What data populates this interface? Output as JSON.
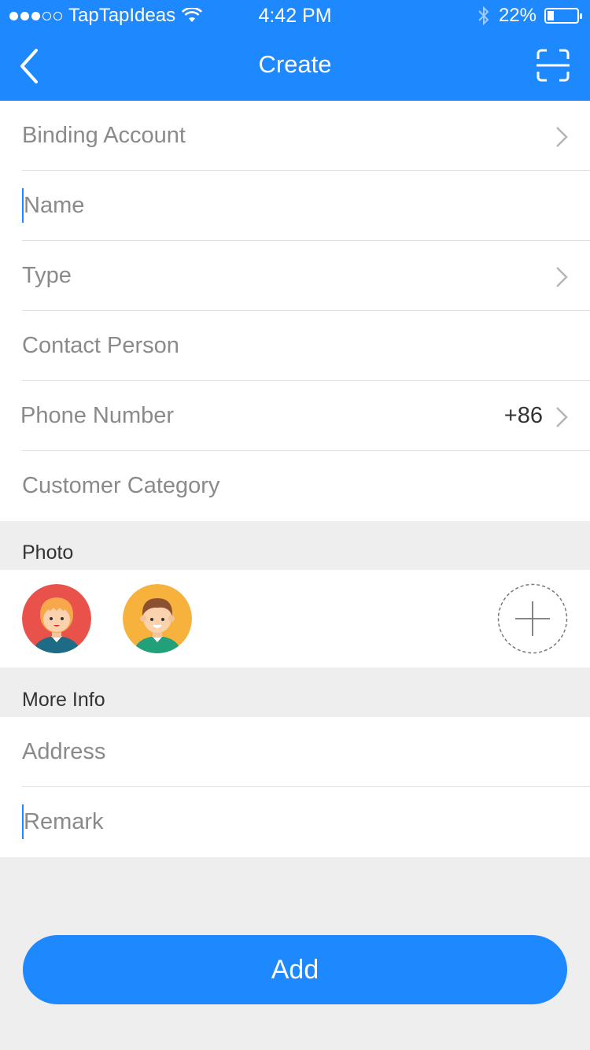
{
  "status_bar": {
    "carrier": "TapTapIdeas",
    "time": "4:42 PM",
    "battery_percent": "22%",
    "battery_level": 0.22,
    "signal_bars": 3,
    "signal_total": 5
  },
  "nav": {
    "title": "Create",
    "back_icon": "chevron-left-icon",
    "scan_icon": "scan-icon"
  },
  "form": {
    "binding_account": "Binding Account",
    "name_placeholder": "Name",
    "type": "Type",
    "contact_person": "Contact Person",
    "phone_number": "Phone Number",
    "phone_code": "+86",
    "customer_category": "Customer Category"
  },
  "photo": {
    "title": "Photo",
    "avatars": [
      "female-avatar",
      "male-avatar"
    ],
    "add_icon": "plus-icon"
  },
  "more_info": {
    "title": "More Info",
    "address": "Address",
    "remark_placeholder": "Remark"
  },
  "actions": {
    "add_label": "Add"
  },
  "colors": {
    "accent": "#1e88ff",
    "background": "#eeeeee",
    "avatar_female_bg": "#e8524a",
    "avatar_male_bg": "#f7b13d"
  }
}
